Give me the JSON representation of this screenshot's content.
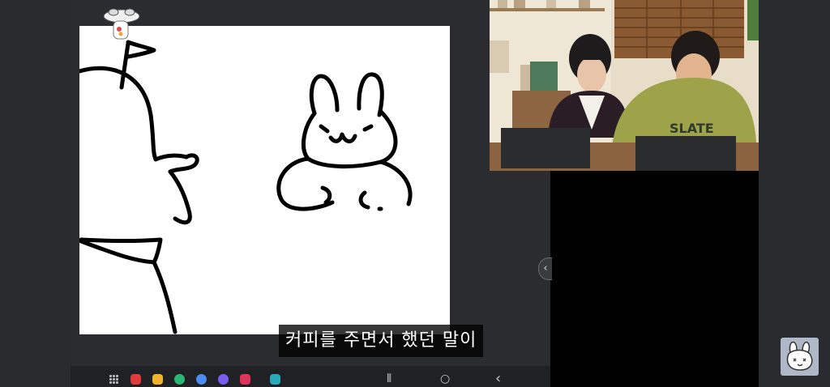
{
  "subtitle": {
    "text": "커피를 주면서 했던 말이"
  },
  "taskbar": {
    "apps": [
      {
        "icon": "flipboard-icon",
        "color": "#e23b3b"
      },
      {
        "icon": "files-folder-icon",
        "color": "#f0b22a"
      },
      {
        "icon": "phone-app-icon",
        "color": "#2bb673"
      },
      {
        "icon": "messages-icon",
        "color": "#4a8cf0"
      },
      {
        "icon": "browser-icon",
        "color": "#7b5cf0"
      },
      {
        "icon": "screen-recorder-icon",
        "color": "#e0325a"
      },
      {
        "icon": "spreadsheet-icon",
        "color": "#29a8b8"
      }
    ],
    "nav": {
      "recents_glyph": "⦀",
      "home_glyph": "○",
      "back_glyph": "‹"
    }
  },
  "panel": {
    "collapse_glyph": "‹"
  },
  "colors": {
    "canvas": "#ffffff",
    "ink": "#000000",
    "tablet_bezel": "#2b2c30",
    "background": "#1f2023"
  }
}
